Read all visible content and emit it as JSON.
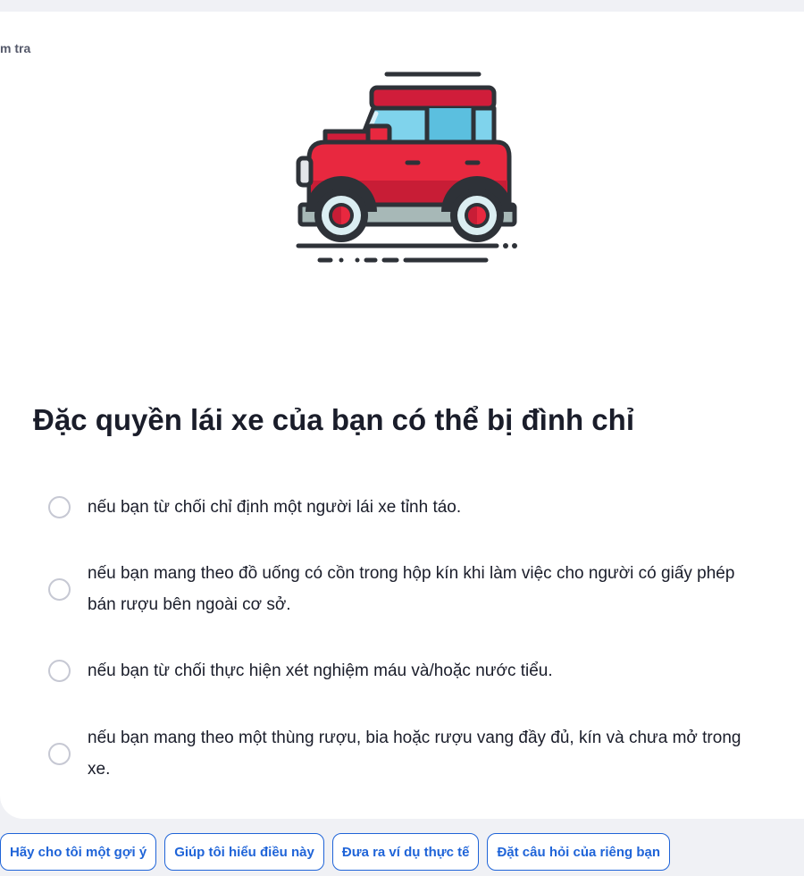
{
  "header": {
    "crumb": "m tra"
  },
  "illustration": {
    "icon": "jeep-car-icon",
    "colors": {
      "body": "#e8283f",
      "body_dark": "#c81d36",
      "window": "#7fd3ec",
      "outline": "#2e3238",
      "bumper": "#a7b8b7"
    }
  },
  "question": {
    "text": "Đặc quyền lái xe của bạn có thể bị đình chỉ"
  },
  "options": [
    {
      "text": "nếu bạn từ chối chỉ định một người lái xe tỉnh táo."
    },
    {
      "text": "nếu bạn mang theo đồ uống có cồn trong hộp kín khi làm việc cho người có giấy phép bán rượu bên ngoài cơ sở."
    },
    {
      "text": "nếu bạn từ chối thực hiện xét nghiệm máu và/hoặc nước tiểu."
    },
    {
      "text": "nếu bạn mang theo một thùng rượu, bia hoặc rượu vang đầy đủ, kín và chưa mở trong xe."
    }
  ],
  "help_chips": [
    {
      "label": "Hãy cho tôi một gợi ý"
    },
    {
      "label": "Giúp tôi hiểu điều này"
    },
    {
      "label": "Đưa ra ví dụ thực tế"
    },
    {
      "label": "Đặt câu hỏi của riêng bạn"
    }
  ],
  "theme": {
    "accent": "#1f64d8",
    "background": "#f0f1f5",
    "card": "#ffffff"
  }
}
